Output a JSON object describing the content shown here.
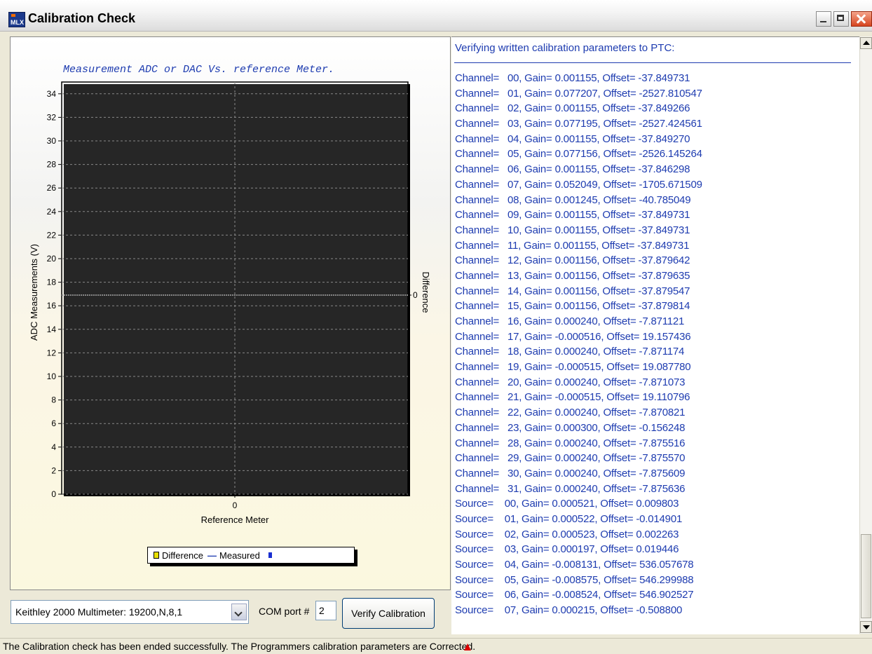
{
  "window": {
    "title": "Calibration Check",
    "icon": "mlx-app-icon",
    "icon_text": "MLX"
  },
  "chart_data": {
    "type": "line",
    "title": "Measurement ADC or DAC Vs. reference Meter.",
    "xlabel": "Reference Meter",
    "ylabel": "ADC Measurements (V)",
    "y2label": "Difference",
    "ylim": [
      0,
      35
    ],
    "yticks": [
      0,
      2,
      4,
      6,
      8,
      10,
      12,
      14,
      16,
      18,
      20,
      22,
      24,
      26,
      28,
      30,
      32,
      34
    ],
    "xticks": [
      0
    ],
    "y2ticks": [
      0
    ],
    "grid": true,
    "legend_position": "bottom-center",
    "series": [
      {
        "name": "Difference",
        "values": []
      },
      {
        "name": "Measured",
        "values": []
      }
    ],
    "legend": [
      "Difference",
      "Measured"
    ]
  },
  "log": {
    "header": "Verifying written calibration parameters to PTC:",
    "lines": [
      "Channel=   00, Gain= 0.001155, Offset= -37.849731",
      "Channel=   01, Gain= 0.077207, Offset= -2527.810547",
      "Channel=   02, Gain= 0.001155, Offset= -37.849266",
      "Channel=   03, Gain= 0.077195, Offset= -2527.424561",
      "Channel=   04, Gain= 0.001155, Offset= -37.849270",
      "Channel=   05, Gain= 0.077156, Offset= -2526.145264",
      "Channel=   06, Gain= 0.001155, Offset= -37.846298",
      "Channel=   07, Gain= 0.052049, Offset= -1705.671509",
      "Channel=   08, Gain= 0.001245, Offset= -40.785049",
      "Channel=   09, Gain= 0.001155, Offset= -37.849731",
      "Channel=   10, Gain= 0.001155, Offset= -37.849731",
      "Channel=   11, Gain= 0.001155, Offset= -37.849731",
      "Channel=   12, Gain= 0.001156, Offset= -37.879642",
      "Channel=   13, Gain= 0.001156, Offset= -37.879635",
      "Channel=   14, Gain= 0.001156, Offset= -37.879547",
      "Channel=   15, Gain= 0.001156, Offset= -37.879814",
      "Channel=   16, Gain= 0.000240, Offset= -7.871121",
      "Channel=   17, Gain= -0.000516, Offset= 19.157436",
      "Channel=   18, Gain= 0.000240, Offset= -7.871174",
      "Channel=   19, Gain= -0.000515, Offset= 19.087780",
      "Channel=   20, Gain= 0.000240, Offset= -7.871073",
      "Channel=   21, Gain= -0.000515, Offset= 19.110796",
      "Channel=   22, Gain= 0.000240, Offset= -7.870821",
      "Channel=   23, Gain= 0.000300, Offset= -0.156248",
      "Channel=   28, Gain= 0.000240, Offset= -7.875516",
      "Channel=   29, Gain= 0.000240, Offset= -7.875570",
      "Channel=   30, Gain= 0.000240, Offset= -7.875609",
      "Channel=   31, Gain= 0.000240, Offset= -7.875636",
      "Source=    00, Gain= 0.000521, Offset= 0.009803",
      "Source=    01, Gain= 0.000522, Offset= -0.014901",
      "Source=    02, Gain= 0.000523, Offset= 0.002263",
      "Source=    03, Gain= 0.000197, Offset= 0.019446",
      "Source=    04, Gain= -0.008131, Offset= 536.057678",
      "Source=    05, Gain= -0.008575, Offset= 546.299988",
      "Source=    06, Gain= -0.008524, Offset= 546.902527",
      "Source=    07, Gain= 0.000215, Offset= -0.508800"
    ]
  },
  "controls": {
    "device_selected": "Keithley 2000 Multimeter: 19200,N,8,1",
    "com_label": "COM port #",
    "com_value": "2",
    "verify_label": "Verify Calibration"
  },
  "status": {
    "text": "The Calibration check has been ended successfully. The Programmers calibration parameters are Corrected."
  },
  "colors": {
    "accent": "#1e3cb0",
    "window_bg": "#ece9d8"
  }
}
